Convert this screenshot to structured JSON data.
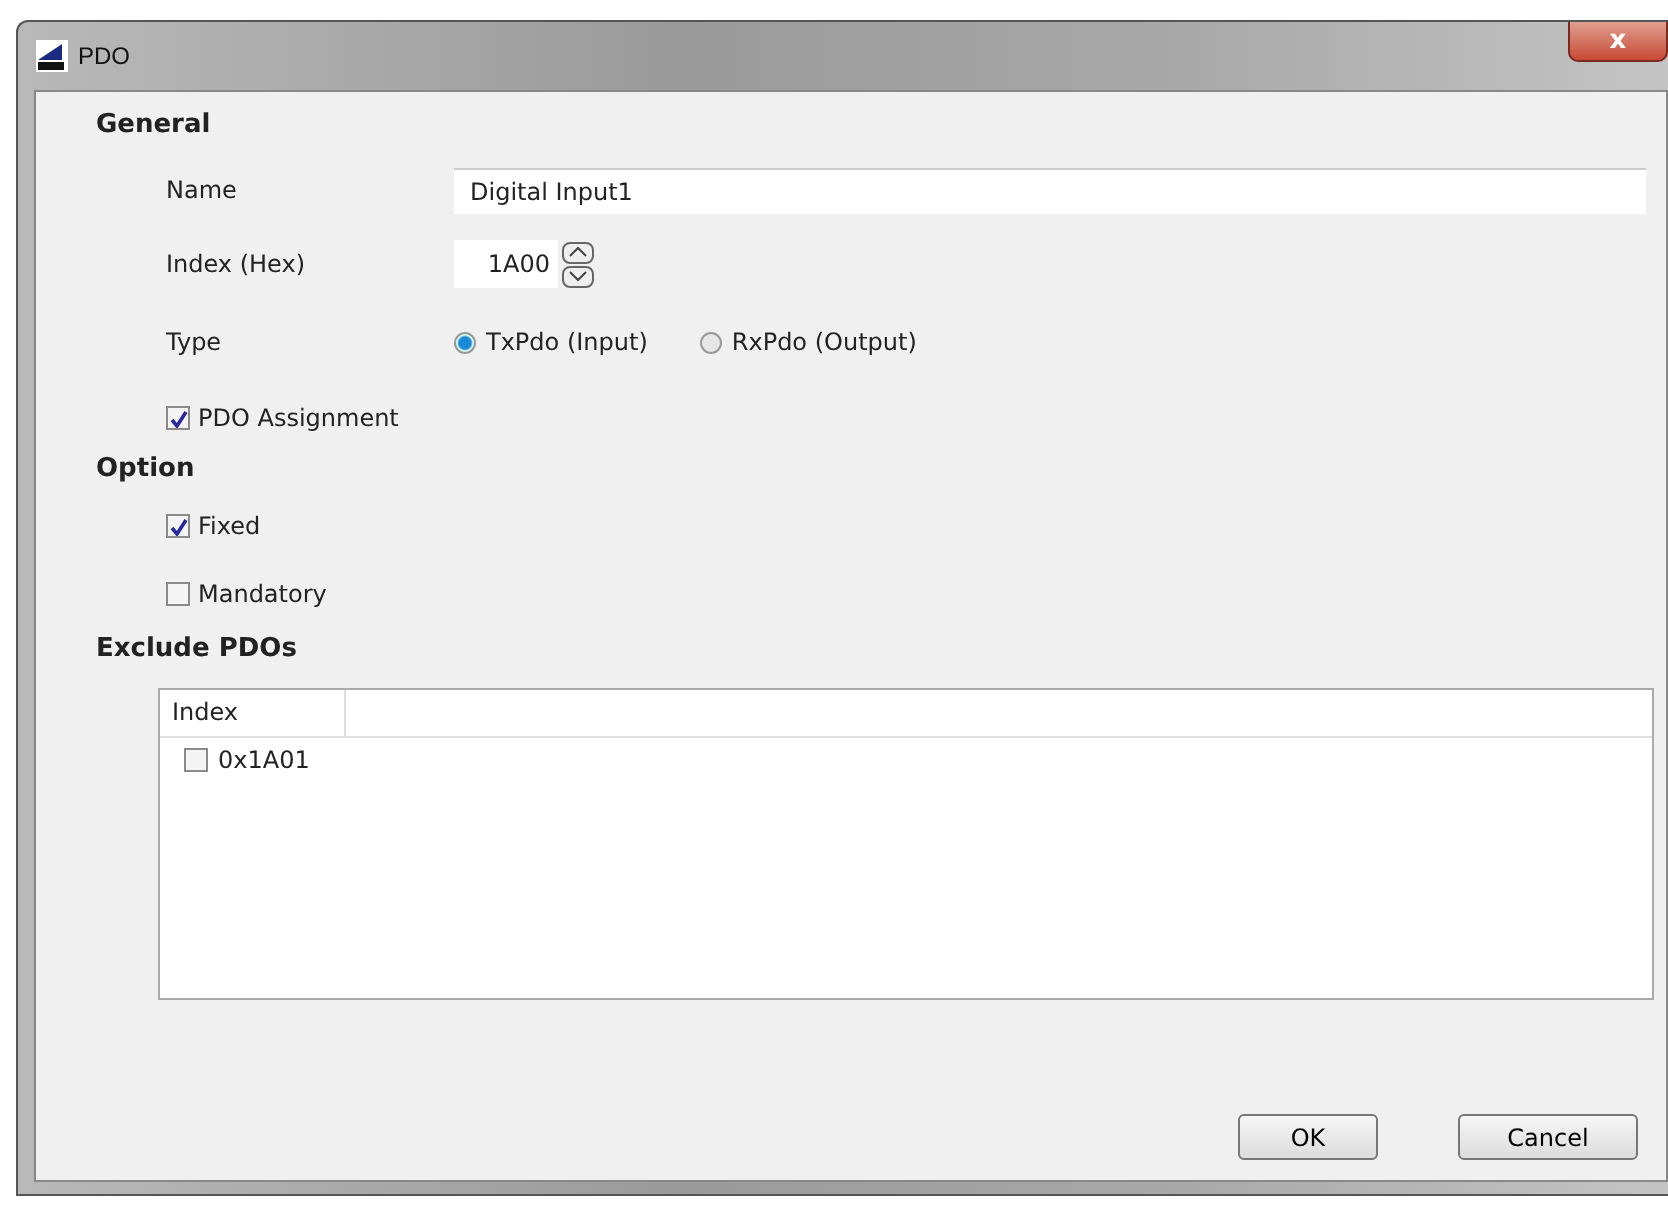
{
  "window": {
    "title": "PDO",
    "close": "x"
  },
  "general": {
    "heading": "General",
    "name": {
      "label": "Name",
      "value": "Digital Input1"
    },
    "index": {
      "label": "Index (Hex)",
      "value": "1A00"
    },
    "type": {
      "label": "Type",
      "options": [
        {
          "label": "TxPdo (Input)",
          "selected": true
        },
        {
          "label": "RxPdo (Output)",
          "selected": false
        }
      ]
    },
    "assignment": {
      "label": "PDO Assignment",
      "checked": true
    }
  },
  "option": {
    "heading": "Option",
    "items": [
      {
        "label": "Fixed",
        "checked": true
      },
      {
        "label": "Mandatory",
        "checked": false
      }
    ]
  },
  "exclude": {
    "heading": "Exclude PDOs",
    "columns": [
      "Index"
    ],
    "rows": [
      {
        "label": "0x1A01",
        "checked": false
      }
    ]
  },
  "buttons": [
    "OK",
    "Cancel"
  ]
}
